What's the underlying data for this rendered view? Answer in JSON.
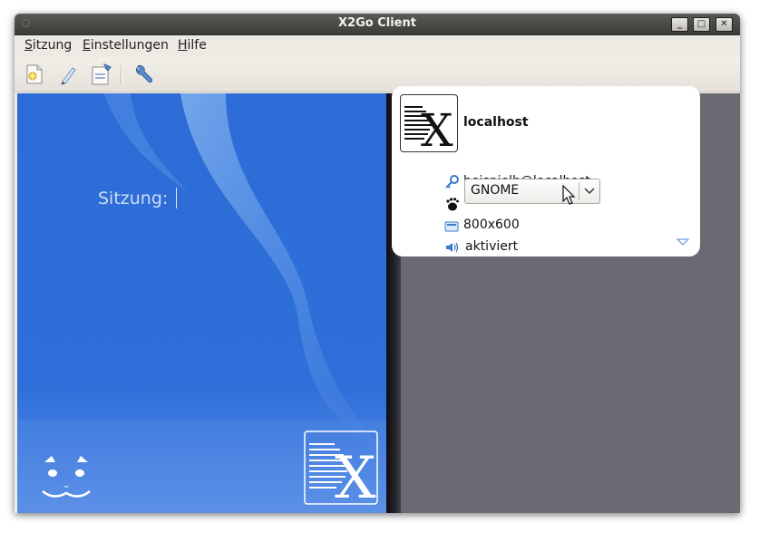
{
  "window": {
    "title": "X2Go Client"
  },
  "window_buttons": [
    {
      "name": "minimize-button",
      "glyph": "_"
    },
    {
      "name": "maximize-button",
      "glyph": "□"
    },
    {
      "name": "close-button",
      "glyph": "✕"
    }
  ],
  "menubar": {
    "items": [
      {
        "accel": "S",
        "rest": "itzung"
      },
      {
        "accel": "E",
        "rest": "instellungen"
      },
      {
        "accel": "H",
        "rest": "ilfe"
      }
    ]
  },
  "toolbar": {
    "icons": [
      "new-session-icon",
      "edit-session-icon",
      "session-manage-icon",
      "settings-wrench-icon"
    ]
  },
  "login": {
    "session_label": "Sitzung:",
    "session_value": ""
  },
  "session_card": {
    "name": "localhost",
    "user": "beispielb@localhost",
    "session_type": "GNOME",
    "resolution": "800x600",
    "sound": "aktiviert"
  },
  "colors": {
    "left_pane_blue": "#2a6ad6",
    "right_pane_gray": "#6a6a72",
    "title_bar": "#3c3b37"
  }
}
